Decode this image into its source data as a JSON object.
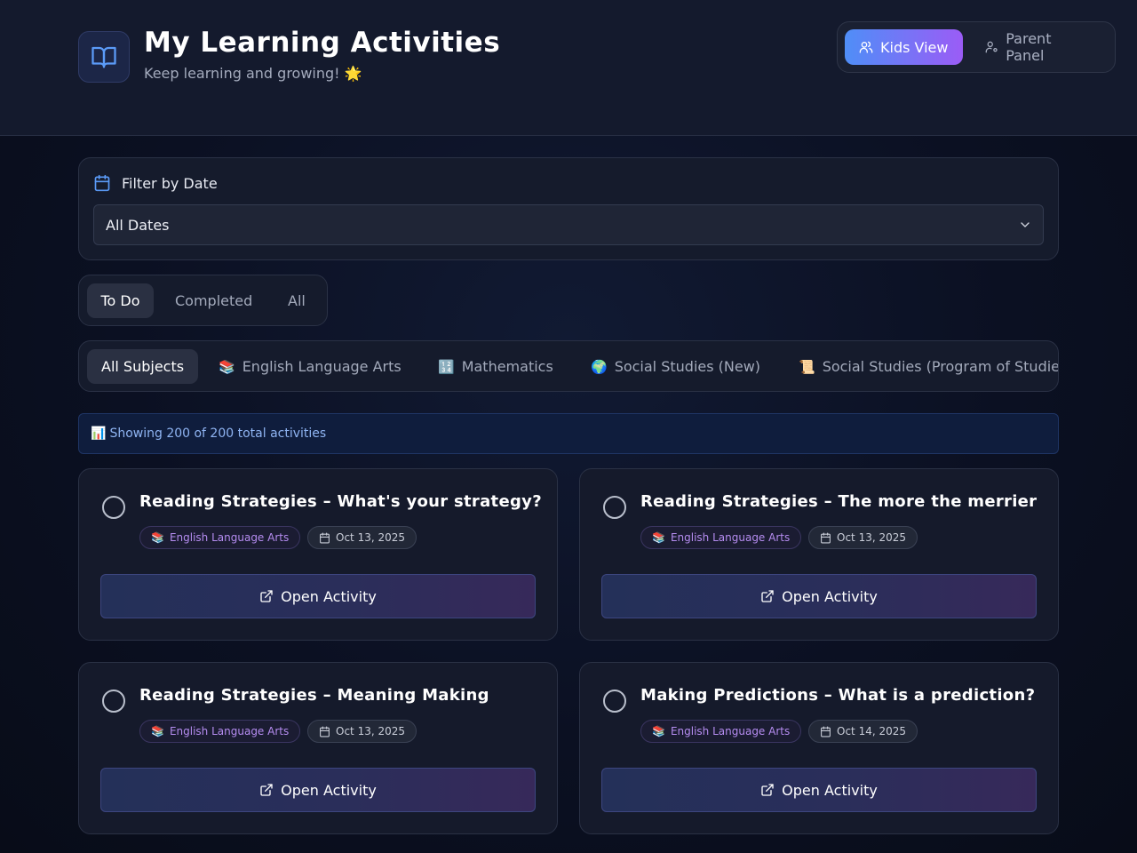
{
  "header": {
    "title": "My Learning Activities",
    "subtitle": "Keep learning and growing! 🌟",
    "logo_icon": "book-open-icon",
    "view_switch": {
      "kids_label": "Kids View",
      "parent_label": "Parent Panel",
      "active": "Kids View"
    }
  },
  "filter": {
    "label": "Filter by Date",
    "selected": "All Dates"
  },
  "status_tabs": [
    "To Do",
    "Completed",
    "All"
  ],
  "status_active": "To Do",
  "subject_tabs": [
    {
      "emoji": "",
      "label": "All Subjects"
    },
    {
      "emoji": "📚",
      "label": "English Language Arts"
    },
    {
      "emoji": "🔢",
      "label": "Mathematics"
    },
    {
      "emoji": "🌍",
      "label": "Social Studies (New)"
    },
    {
      "emoji": "📜",
      "label": "Social Studies (Program of Studies)"
    }
  ],
  "subject_active": "All Subjects",
  "info": {
    "icon": "📊",
    "text": "Showing 200 of 200 total activities"
  },
  "activities": [
    {
      "title": "Reading Strategies – What's your strategy?",
      "subject_emoji": "📚",
      "subject": "English Language Arts",
      "date": "Oct 13, 2025",
      "button": "Open Activity"
    },
    {
      "title": "Reading Strategies – The more the merrier",
      "subject_emoji": "📚",
      "subject": "English Language Arts",
      "date": "Oct 13, 2025",
      "button": "Open Activity"
    },
    {
      "title": "Reading Strategies – Meaning Making",
      "subject_emoji": "📚",
      "subject": "English Language Arts",
      "date": "Oct 13, 2025",
      "button": "Open Activity"
    },
    {
      "title": "Making Predictions – What is a prediction?",
      "subject_emoji": "📚",
      "subject": "English Language Arts",
      "date": "Oct 14, 2025",
      "button": "Open Activity"
    }
  ],
  "colors": {
    "accent_blue": "#4f8ef7",
    "accent_purple": "#9b5cf6",
    "subject_tag_text": "#b58cf0",
    "banner_text": "#8fb4f2"
  }
}
